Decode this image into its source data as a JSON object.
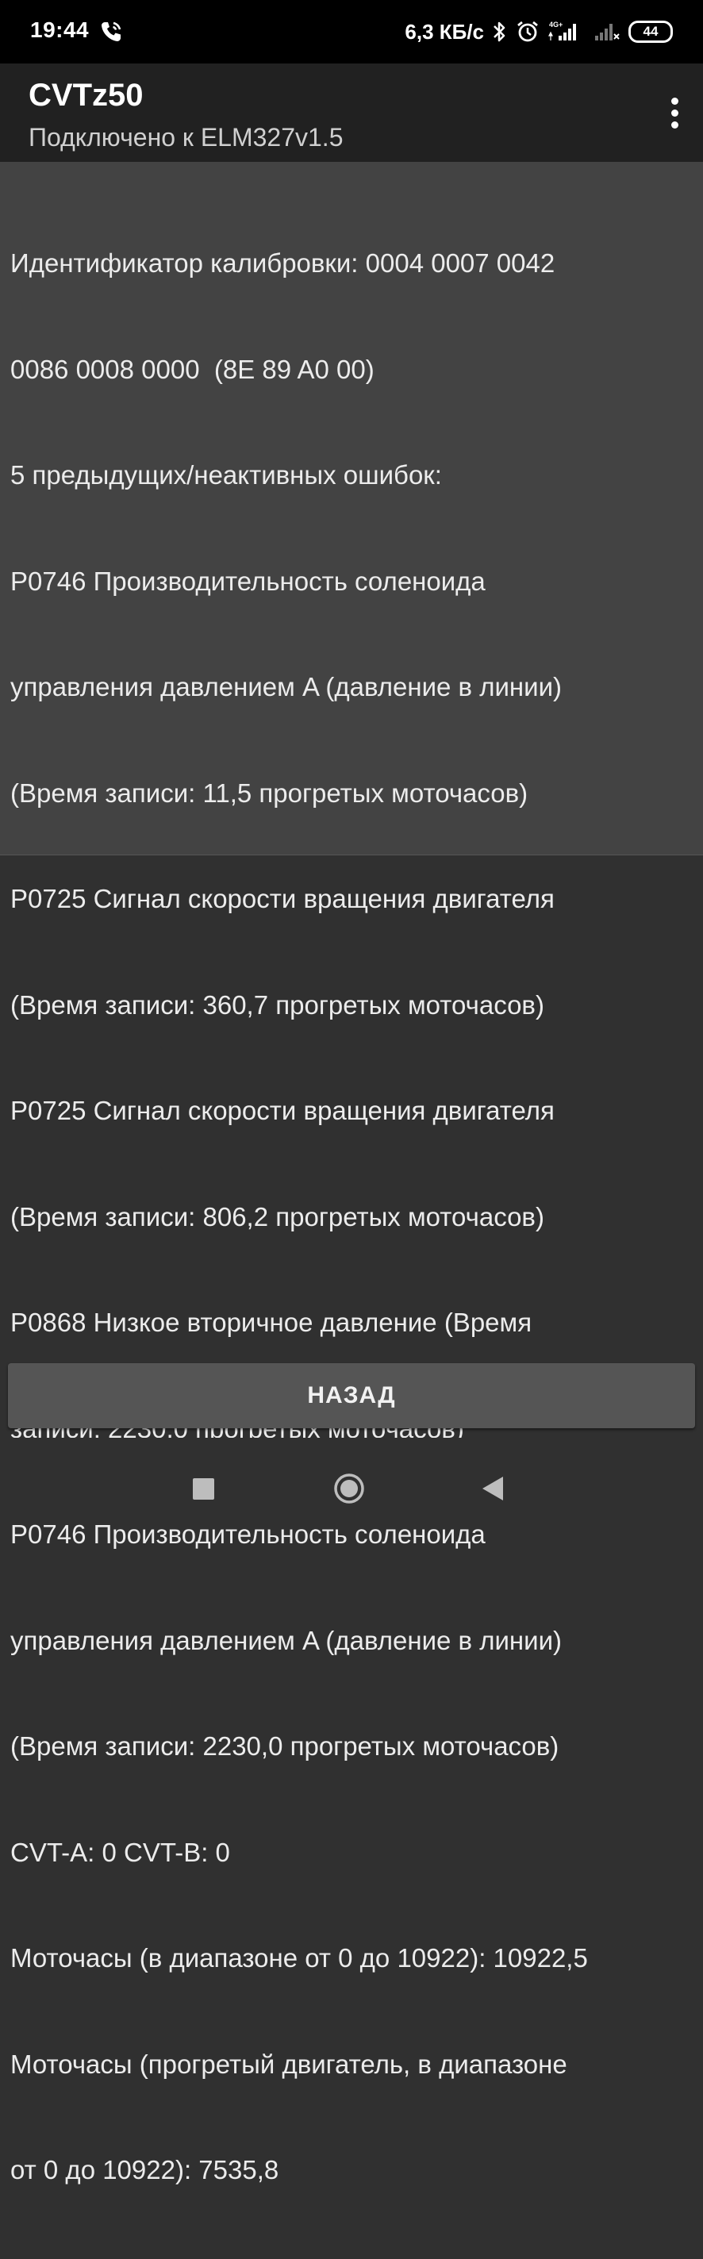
{
  "status_bar": {
    "time": "19:44",
    "call_icon": "phone-call-icon",
    "network_speed": "6,3 КБ/с",
    "bluetooth_icon": "bluetooth-icon",
    "alarm_icon": "alarm-icon",
    "network_type": "4G+",
    "signal_icon": "signal-icon",
    "battery": "44"
  },
  "app_bar": {
    "title": "CVTz50",
    "subtitle": "Подключено к ELM327v1.5",
    "overflow_icon": "more-vert-icon"
  },
  "report": {
    "lines": [
      "Идентификатор калибровки: 0004 0007 0042",
      "0086 0008 0000  (8E 89 A0 00)",
      "5 предыдущих/неактивных ошибок:",
      "P0746 Производительность соленоида",
      "управления давлением A (давление в линии)",
      "(Время записи: 11,5 прогретых моточасов)",
      "P0725 Сигнал скорости вращения двигателя",
      "(Время записи: 360,7 прогретых моточасов)",
      "P0725 Сигнал скорости вращения двигателя",
      "(Время записи: 806,2 прогретых моточасов)",
      "P0868 Низкое вторичное давление (Время",
      "записи: 2230,0 прогретых моточасов)",
      "P0746 Производительность соленоида",
      "управления давлением A (давление в линии)",
      "(Время записи: 2230,0 прогретых моточасов)",
      "CVT-A: 0 CVT-B: 0",
      "Моточасы (в диапазоне от 0 до 10922): 10922,5",
      "Моточасы (прогретый двигатель, в диапазоне",
      "от 0 до 10922): 7535,8"
    ]
  },
  "actions": {
    "back_label": "НАЗАД"
  },
  "nav_bar": {
    "recents_icon": "recents-square-icon",
    "home_icon": "home-circle-icon",
    "back_icon": "back-triangle-icon"
  }
}
